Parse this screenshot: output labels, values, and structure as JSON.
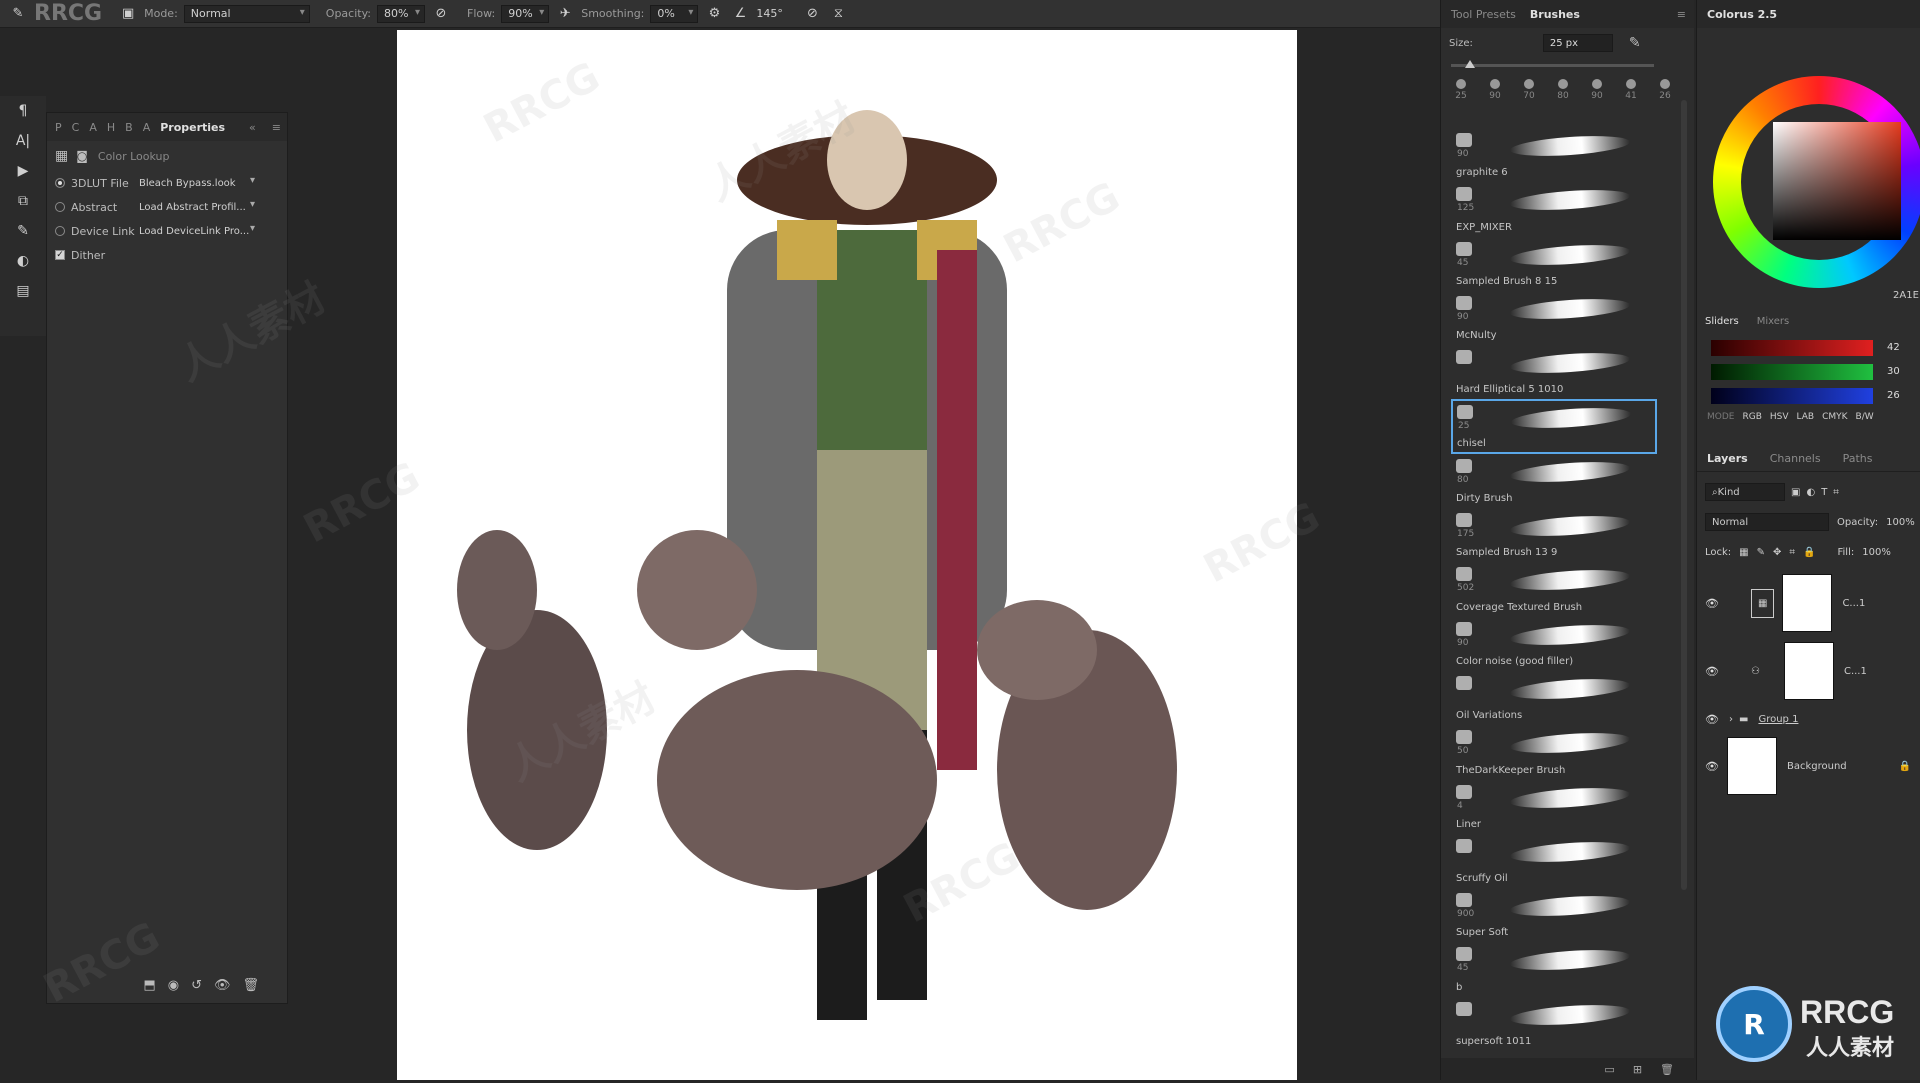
{
  "toolbar": {
    "mode_label": "Mode:",
    "mode_value": "Normal",
    "opacity_label": "Opacity:",
    "opacity_value": "80%",
    "flow_label": "Flow:",
    "flow_value": "90%",
    "smoothing_label": "Smoothing:",
    "smoothing_value": "0%",
    "angle_value": "145°"
  },
  "properties": {
    "tabs": [
      "P",
      "C",
      "A",
      "H",
      "B",
      "A"
    ],
    "title": "Properties",
    "subtitle": "Color Lookup",
    "rows": [
      {
        "label": "3DLUT File",
        "value": "Bleach Bypass.look",
        "selected": true
      },
      {
        "label": "Abstract",
        "value": "Load Abstract Profil...",
        "selected": false
      },
      {
        "label": "Device Link",
        "value": "Load DeviceLink Pro...",
        "selected": false
      }
    ],
    "dither_label": "Dither",
    "dither_checked": true
  },
  "brushes": {
    "tabs": [
      "Tool Presets",
      "Brushes"
    ],
    "size_label": "Size:",
    "size_value": "25 px",
    "preset_sizes": [
      "25",
      "90",
      "70",
      "80",
      "90",
      "41",
      "26"
    ],
    "items": [
      {
        "num": "90",
        "name": "graphite 6",
        "selected": false
      },
      {
        "num": "125",
        "name": "EXP_MIXER",
        "selected": false
      },
      {
        "num": "45",
        "name": "Sampled Brush 8 15",
        "selected": false
      },
      {
        "num": "90",
        "name": "McNulty",
        "selected": false
      },
      {
        "num": "",
        "name": "Hard Elliptical 5 1010",
        "selected": false
      },
      {
        "num": "25",
        "name": "chisel",
        "selected": true
      },
      {
        "num": "80",
        "name": "Dirty Brush",
        "selected": false
      },
      {
        "num": "175",
        "name": "Sampled Brush 13 9",
        "selected": false
      },
      {
        "num": "502",
        "name": "Coverage Textured Brush",
        "selected": false
      },
      {
        "num": "90",
        "name": "Color noise (good filler)",
        "selected": false
      },
      {
        "num": "",
        "name": "Oil Variations",
        "selected": false
      },
      {
        "num": "50",
        "name": "TheDarkKeeper Brush",
        "selected": false
      },
      {
        "num": "4",
        "name": "Liner",
        "selected": false
      },
      {
        "num": "",
        "name": "Scruffy Oil",
        "selected": false
      },
      {
        "num": "900",
        "name": "Super Soft",
        "selected": false
      },
      {
        "num": "45",
        "name": "b",
        "selected": false
      },
      {
        "num": "",
        "name": "supersoft 1011",
        "selected": false
      }
    ]
  },
  "colorus": {
    "title": "Colorus 2.5",
    "hex": "2A1E",
    "slider_tabs": [
      "Sliders",
      "Mixers"
    ],
    "r": "42",
    "g": "30",
    "b": "26",
    "mode_label": "MODE",
    "modes": [
      "RGB",
      "HSV",
      "LAB",
      "CMYK",
      "B/W"
    ]
  },
  "layers": {
    "tabs": [
      "Layers",
      "Channels",
      "Paths"
    ],
    "kind_label": "Kind",
    "blend_mode": "Normal",
    "opacity_label": "Opacity:",
    "opacity_value": "100%",
    "lock_label": "Lock:",
    "fill_label": "Fill:",
    "fill_value": "100%",
    "items": [
      {
        "name": "C...1"
      },
      {
        "name": "C...1"
      },
      {
        "name": "Group 1"
      },
      {
        "name": "Background"
      }
    ]
  },
  "watermark": {
    "text": "RRCG",
    "logo_text": "RRCG",
    "logo_sub": "人人素材",
    "cn_text": "人人素材"
  },
  "colors": {
    "selection": "#5aa7e8",
    "panel": "#2d2d2d",
    "canvas": "#ffffff"
  }
}
